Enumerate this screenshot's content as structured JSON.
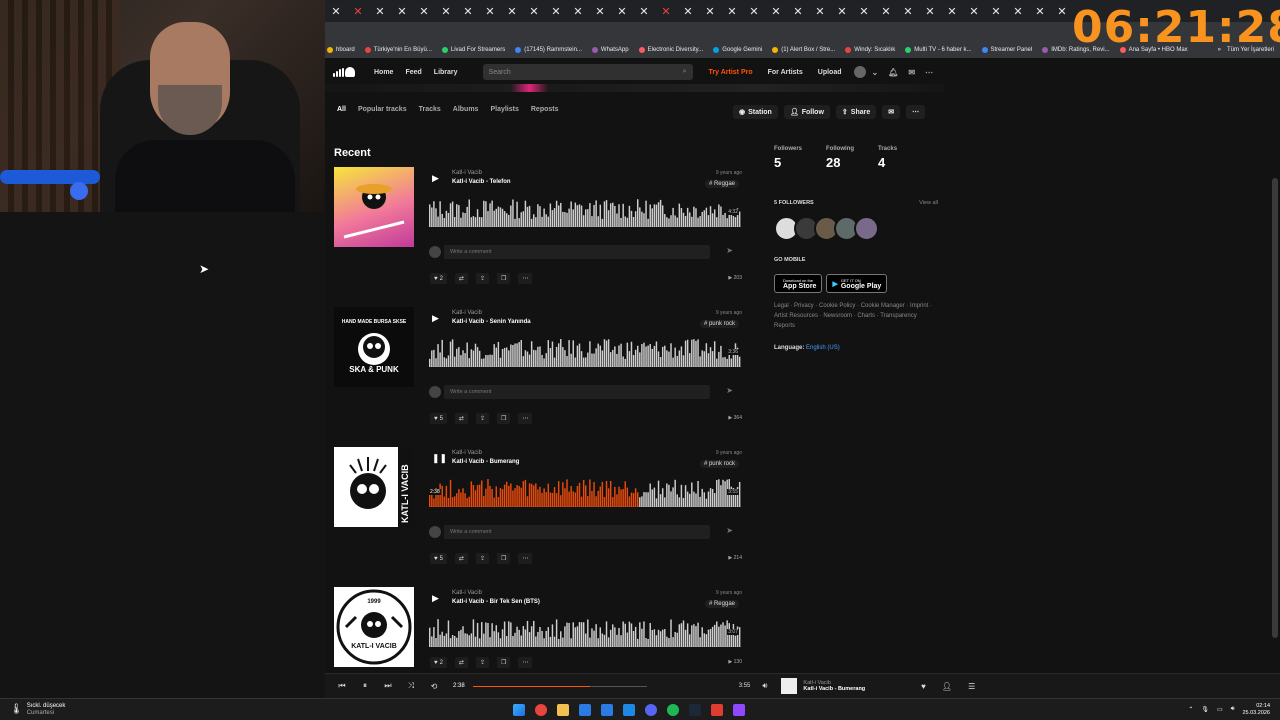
{
  "overlay": {
    "clock": "06:21:28"
  },
  "browser": {
    "bookmarks": [
      "hboard",
      "Türkiye'nin En Büyü...",
      "Livad For Streamers",
      "(17145) Rammstein...",
      "WhatsApp",
      "Electronic Diversity...",
      "Google Gemini",
      "(1) Alert Box / Stre...",
      "Windy: Sıcaklık",
      "Multi TV - 6 haber k...",
      "Streamer Panel",
      "IMDb: Ratings, Revi...",
      "Ana Sayfa • HBO Max"
    ],
    "all_bookmarks": "Tüm Yer İşaretleri"
  },
  "sc_header": {
    "nav": [
      "Home",
      "Feed",
      "Library"
    ],
    "search_placeholder": "Search",
    "try_pro": "Try Artist Pro",
    "for_artists": "For Artists",
    "upload": "Upload"
  },
  "profile_tabs": [
    "All",
    "Popular tracks",
    "Tracks",
    "Albums",
    "Playlists",
    "Reposts"
  ],
  "profile_actions": {
    "station": "Station",
    "follow": "Follow",
    "share": "Share"
  },
  "section_title": "Recent",
  "comment_placeholder": "Write a comment",
  "tracks": [
    {
      "artist": "Katl-i Vacib",
      "title": "Katl-i Vacib - Telefon",
      "date": "9 years ago",
      "tag": "# Reggae",
      "duration": "4:32",
      "likes": "2",
      "plays": "203"
    },
    {
      "artist": "Katl-i Vacib",
      "title": "Katl-i Vacib - Senin Yanında",
      "date": "9 years ago",
      "tag": "# punk rock",
      "duration": "3:36",
      "likes": "5",
      "plays": "364"
    },
    {
      "artist": "Katl-i Vacib",
      "title": "Katl-i Vacib - Bumerang",
      "date": "9 years ago",
      "tag": "# punk rock",
      "duration": "3:55",
      "position": "2:38",
      "likes": "5",
      "plays": "214"
    },
    {
      "artist": "Katl-i Vacib",
      "title": "Katl-i Vacib - Bir Tek Sen (BTS)",
      "date": "9 years ago",
      "tag": "# Reggae",
      "duration": "3:07",
      "likes": "2",
      "plays": "130"
    }
  ],
  "artwork_text": {
    "t1": "",
    "t2_top": "HAND MADE BURSA SKSE",
    "t2_bottom": "SKA & PUNK",
    "t3": "KATL-I VACIB",
    "t4_year": "1999",
    "t4_name": "KATL-I VACIB"
  },
  "sidebar": {
    "stats": [
      {
        "label": "Followers",
        "value": "5"
      },
      {
        "label": "Following",
        "value": "28"
      },
      {
        "label": "Tracks",
        "value": "4"
      }
    ],
    "followers_heading": "5 FOLLOWERS",
    "view_all": "View all",
    "go_mobile": "GO MOBILE",
    "app_store_small": "Download on the",
    "app_store": "App Store",
    "google_play_small": "GET IT ON",
    "google_play": "Google Play",
    "legal": "Legal · Privacy · Cookie Policy · Cookie Manager · Imprint · Artist Resources · Newsroom · Charts · Transparency Reports",
    "language_label": "Language:",
    "language_value": "English (US)"
  },
  "player": {
    "elapsed": "2:38",
    "total": "3:55",
    "progress": 0.672,
    "artist": "Katl-i Vacib",
    "title": "Katl-i Vacib - Bumerang"
  },
  "taskbar": {
    "weather_title": "Sıckl. düşecek",
    "weather_sub": "Cumartesi",
    "time": "02:14",
    "date": "25.03.2026"
  },
  "colors": {
    "accent": "#ff5500",
    "wave_played": "#e84a0c"
  }
}
